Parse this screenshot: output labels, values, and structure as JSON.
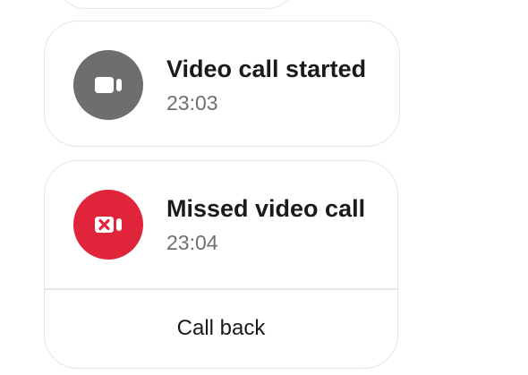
{
  "events": [
    {
      "title": "Video call started",
      "time": "23:03",
      "icon": "video-camera-icon",
      "icon_bg": "#6e6e6e"
    },
    {
      "title": "Missed video call",
      "time": "23:04",
      "icon": "missed-video-call-icon",
      "icon_bg": "#e0253a",
      "action_label": "Call back"
    }
  ]
}
